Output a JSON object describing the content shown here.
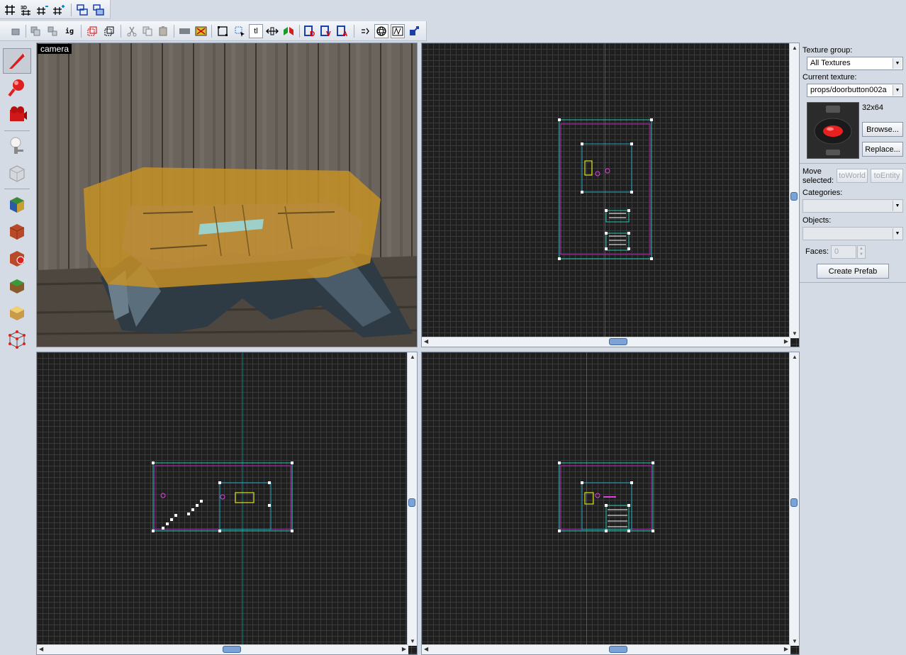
{
  "toolbar_top": {
    "buttons": [
      {
        "icon": "grid-icon",
        "label": "#"
      },
      {
        "icon": "grid-3d-icon",
        "label": "3D"
      },
      {
        "icon": "grid-smaller-icon",
        "label": "#"
      },
      {
        "icon": "grid-larger-icon",
        "label": "#"
      },
      {
        "icon": "carve-icon",
        "label": ""
      },
      {
        "icon": "group-icon",
        "label": ""
      }
    ]
  },
  "toolbar_main": {
    "buttons": [
      {
        "icon": "undo-icon"
      },
      {
        "icon": "group-objects-icon"
      },
      {
        "icon": "ungroup-icon"
      },
      {
        "icon": "ignore-grouping-icon",
        "label": "ig"
      },
      {
        "icon": "hide-selection-icon"
      },
      {
        "icon": "hide-unselected-icon"
      },
      {
        "icon": "cut-icon"
      },
      {
        "icon": "copy-icon"
      },
      {
        "icon": "paste-icon"
      },
      {
        "icon": "solid-icon"
      },
      {
        "icon": "texture-lock-icon"
      },
      {
        "icon": "select-box-icon"
      },
      {
        "icon": "select-pointer-icon"
      },
      {
        "icon": "texture-lock-text-icon",
        "label": "tl"
      },
      {
        "icon": "scale-icon"
      },
      {
        "icon": "flip-icon"
      },
      {
        "icon": "align-d-icon"
      },
      {
        "icon": "align-v-icon"
      },
      {
        "icon": "align-a-icon"
      },
      {
        "icon": "entity-report-icon"
      },
      {
        "icon": "sphere-icon"
      },
      {
        "icon": "map-icon"
      },
      {
        "icon": "compile-icon"
      }
    ]
  },
  "tools": [
    {
      "name": "selection-tool-icon",
      "active": true
    },
    {
      "name": "magnify-tool-icon"
    },
    {
      "name": "camera-tool-icon"
    },
    {
      "name": "entity-tool-icon"
    },
    {
      "name": "block-tool-icon"
    },
    {
      "name": "texture-application-icon"
    },
    {
      "name": "apply-texture-icon"
    },
    {
      "name": "decal-tool-icon"
    },
    {
      "name": "overlay-tool-icon"
    },
    {
      "name": "clipping-tool-icon"
    },
    {
      "name": "vertex-tool-icon"
    }
  ],
  "viewports": {
    "camera_label": "camera"
  },
  "right_panel": {
    "texture_group_label": "Texture group:",
    "texture_group_value": "All Textures",
    "current_texture_label": "Current texture:",
    "current_texture_value": "props/doorbutton002a",
    "texture_size": "32x64",
    "browse_label": "Browse...",
    "replace_label": "Replace...",
    "move_selected_label": "Move selected:",
    "to_world_label": "toWorld",
    "to_entity_label": "toEntity",
    "categories_label": "Categories:",
    "categories_value": "",
    "objects_label": "Objects:",
    "objects_value": "",
    "faces_label": "Faces:",
    "faces_value": "0",
    "create_prefab_label": "Create Prefab"
  }
}
